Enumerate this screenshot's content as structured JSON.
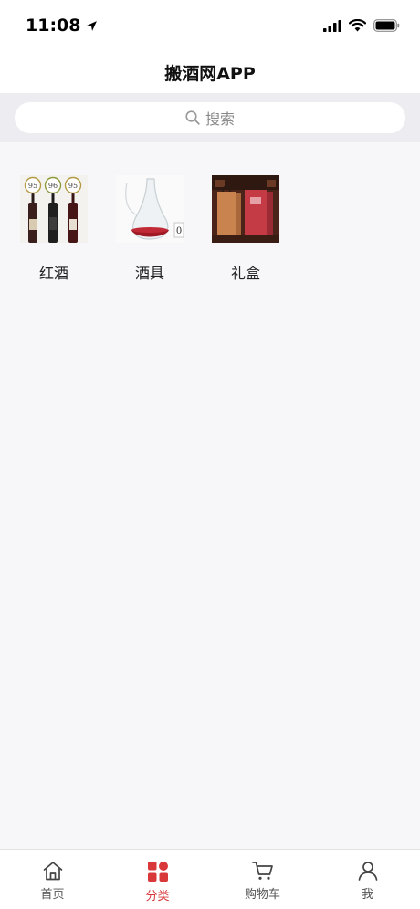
{
  "status_bar": {
    "time": "11:08"
  },
  "nav": {
    "title": "搬酒网APP"
  },
  "search": {
    "placeholder": "搜索"
  },
  "categories": [
    {
      "label": "红酒",
      "badges": [
        "95",
        "96",
        "95"
      ]
    },
    {
      "label": "酒具",
      "badges": [
        "0"
      ]
    },
    {
      "label": "礼盒"
    }
  ],
  "tabs": [
    {
      "label": "首页",
      "icon": "home-icon"
    },
    {
      "label": "分类",
      "icon": "category-icon",
      "active": true
    },
    {
      "label": "购物车",
      "icon": "cart-icon"
    },
    {
      "label": "我",
      "icon": "user-icon"
    }
  ],
  "colors": {
    "accent": "#d9383b",
    "background": "#f7f7f9",
    "search_band": "#ededf1"
  }
}
